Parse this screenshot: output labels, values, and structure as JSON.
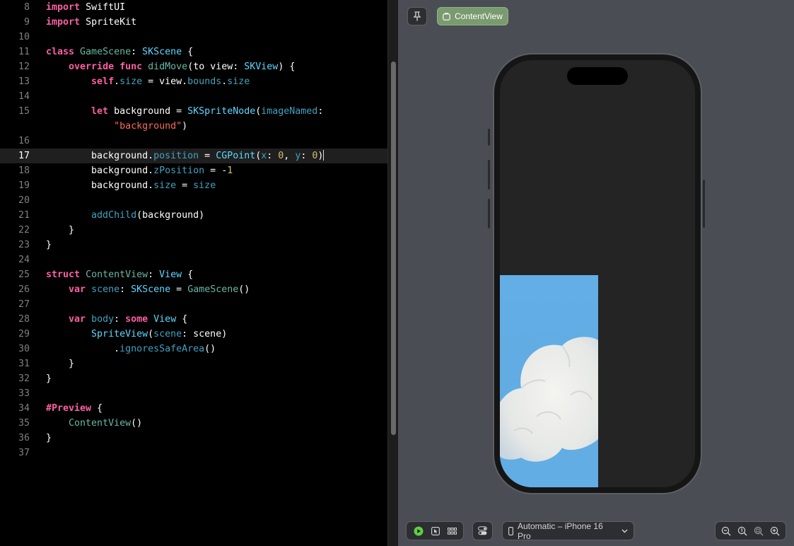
{
  "editor": {
    "lines": [
      {
        "n": "8",
        "tokens": [
          [
            "k",
            "import"
          ],
          [
            "p",
            " "
          ],
          [
            "pl",
            "SwiftUI"
          ]
        ]
      },
      {
        "n": "9",
        "tokens": [
          [
            "k",
            "import"
          ],
          [
            "p",
            " "
          ],
          [
            "pl",
            "SpriteKit"
          ]
        ]
      },
      {
        "n": "10",
        "tokens": []
      },
      {
        "n": "11",
        "tokens": [
          [
            "k",
            "class"
          ],
          [
            "p",
            " "
          ],
          [
            "m",
            "GameScene"
          ],
          [
            "p",
            ": "
          ],
          [
            "t",
            "SKScene"
          ],
          [
            "p",
            " {"
          ]
        ]
      },
      {
        "n": "12",
        "tokens": [
          [
            "p",
            "    "
          ],
          [
            "k",
            "override"
          ],
          [
            "p",
            " "
          ],
          [
            "k",
            "func"
          ],
          [
            "p",
            " "
          ],
          [
            "fn",
            "didMove"
          ],
          [
            "p",
            "("
          ],
          [
            "pl",
            "to"
          ],
          [
            "p",
            " view: "
          ],
          [
            "t",
            "SKView"
          ],
          [
            "p",
            ") {"
          ]
        ]
      },
      {
        "n": "13",
        "tokens": [
          [
            "p",
            "        "
          ],
          [
            "k",
            "self"
          ],
          [
            "p",
            "."
          ],
          [
            "pr",
            "size"
          ],
          [
            "p",
            " = view."
          ],
          [
            "pr",
            "bounds"
          ],
          [
            "p",
            "."
          ],
          [
            "pr",
            "size"
          ]
        ]
      },
      {
        "n": "14",
        "tokens": []
      },
      {
        "n": "15",
        "tokens": [
          [
            "p",
            "        "
          ],
          [
            "k",
            "let"
          ],
          [
            "p",
            " background = "
          ],
          [
            "t",
            "SKSpriteNode"
          ],
          [
            "p",
            "("
          ],
          [
            "pr",
            "imageNamed"
          ],
          [
            "p",
            ":"
          ]
        ]
      },
      {
        "n": "",
        "tokens": [
          [
            "p",
            "            "
          ],
          [
            "s",
            "\"background\""
          ],
          [
            "p",
            ")"
          ]
        ]
      },
      {
        "n": "16",
        "tokens": []
      },
      {
        "n": "17",
        "current": true,
        "tokens": [
          [
            "p",
            "        background."
          ],
          [
            "pr",
            "position"
          ],
          [
            "p",
            " = "
          ],
          [
            "t",
            "CGPoint"
          ],
          [
            "p",
            "("
          ],
          [
            "pr",
            "x"
          ],
          [
            "p",
            ": "
          ],
          [
            "n",
            "0"
          ],
          [
            "p",
            ", "
          ],
          [
            "pr",
            "y"
          ],
          [
            "p",
            ": "
          ],
          [
            "n",
            "0"
          ],
          [
            "p",
            ")"
          ]
        ]
      },
      {
        "n": "18",
        "tokens": [
          [
            "p",
            "        background."
          ],
          [
            "pr",
            "zPosition"
          ],
          [
            "p",
            " = -"
          ],
          [
            "n",
            "1"
          ]
        ]
      },
      {
        "n": "19",
        "tokens": [
          [
            "p",
            "        background."
          ],
          [
            "pr",
            "size"
          ],
          [
            "p",
            " = "
          ],
          [
            "pr",
            "size"
          ]
        ]
      },
      {
        "n": "20",
        "tokens": []
      },
      {
        "n": "21",
        "tokens": [
          [
            "p",
            "        "
          ],
          [
            "pr",
            "addChild"
          ],
          [
            "p",
            "(background)"
          ]
        ]
      },
      {
        "n": "22",
        "tokens": [
          [
            "p",
            "    }"
          ]
        ]
      },
      {
        "n": "23",
        "tokens": [
          [
            "p",
            "}"
          ]
        ]
      },
      {
        "n": "24",
        "tokens": []
      },
      {
        "n": "25",
        "tokens": [
          [
            "k",
            "struct"
          ],
          [
            "p",
            " "
          ],
          [
            "m",
            "ContentView"
          ],
          [
            "p",
            ": "
          ],
          [
            "t",
            "View"
          ],
          [
            "p",
            " {"
          ]
        ]
      },
      {
        "n": "26",
        "tokens": [
          [
            "p",
            "    "
          ],
          [
            "k",
            "var"
          ],
          [
            "p",
            " "
          ],
          [
            "pr",
            "scene"
          ],
          [
            "p",
            ": "
          ],
          [
            "t",
            "SKScene"
          ],
          [
            "p",
            " = "
          ],
          [
            "fn",
            "GameScene"
          ],
          [
            "p",
            "()"
          ]
        ]
      },
      {
        "n": "27",
        "tokens": []
      },
      {
        "n": "28",
        "tokens": [
          [
            "p",
            "    "
          ],
          [
            "k",
            "var"
          ],
          [
            "p",
            " "
          ],
          [
            "pr",
            "body"
          ],
          [
            "p",
            ": "
          ],
          [
            "k",
            "some"
          ],
          [
            "p",
            " "
          ],
          [
            "t",
            "View"
          ],
          [
            "p",
            " {"
          ]
        ]
      },
      {
        "n": "29",
        "tokens": [
          [
            "p",
            "        "
          ],
          [
            "t",
            "SpriteView"
          ],
          [
            "p",
            "("
          ],
          [
            "pr",
            "scene"
          ],
          [
            "p",
            ": scene)"
          ]
        ]
      },
      {
        "n": "30",
        "tokens": [
          [
            "p",
            "            ."
          ],
          [
            "pr",
            "ignoresSafeArea"
          ],
          [
            "p",
            "()"
          ]
        ]
      },
      {
        "n": "31",
        "tokens": [
          [
            "p",
            "    }"
          ]
        ]
      },
      {
        "n": "32",
        "tokens": [
          [
            "p",
            "}"
          ]
        ]
      },
      {
        "n": "33",
        "tokens": []
      },
      {
        "n": "34",
        "tokens": [
          [
            "k",
            "#Preview"
          ],
          [
            "p",
            " {"
          ]
        ]
      },
      {
        "n": "35",
        "tokens": [
          [
            "p",
            "    "
          ],
          [
            "fn",
            "ContentView"
          ],
          [
            "p",
            "()"
          ]
        ]
      },
      {
        "n": "36",
        "tokens": [
          [
            "p",
            "}"
          ]
        ]
      },
      {
        "n": "37",
        "tokens": []
      }
    ]
  },
  "canvas": {
    "preview_tab_label": "ContentView",
    "device_label": "Automatic – iPhone 16 Pro",
    "icons": {
      "pin": "pin-icon",
      "preview_tab": "window-icon",
      "live": "play-icon",
      "selectable": "cursor-icon",
      "variants": "grid-icon",
      "settings": "toggle-icon",
      "device": "phone-icon",
      "chevron": "chevron-down-icon",
      "zoom_out": "zoom-out-icon",
      "zoom_100": "zoom-actual-icon",
      "zoom_fit": "zoom-fit-icon",
      "zoom_in": "zoom-in-icon"
    },
    "colors": {
      "canvas_bg": "#4a4d53",
      "preview_tab_bg": "#7a9a6f",
      "sky": "#63aee6",
      "live_indicator": "#5fcf44"
    }
  }
}
